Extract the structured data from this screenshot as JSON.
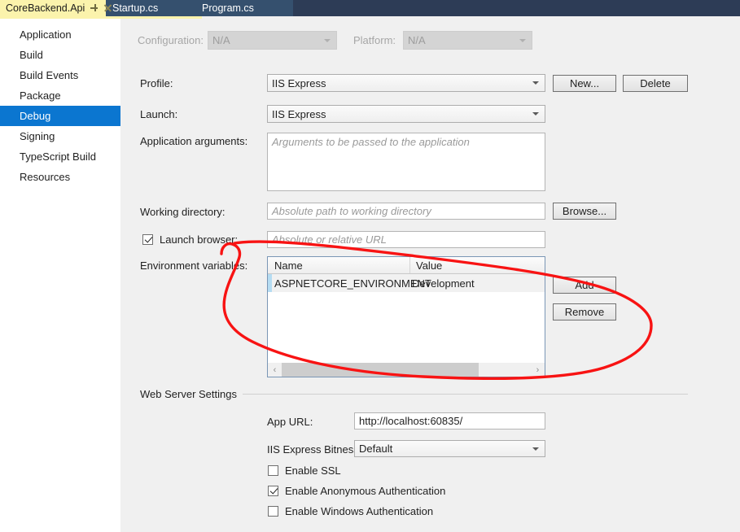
{
  "tabs": {
    "active": {
      "label": "CoreBackend.Api",
      "pin_icon": "pin-icon",
      "close_icon": "close-icon"
    },
    "others": [
      {
        "label": "Startup.cs"
      },
      {
        "label": "Program.cs"
      }
    ]
  },
  "sidebar": {
    "items": [
      {
        "label": "Application",
        "selected": false
      },
      {
        "label": "Build",
        "selected": false
      },
      {
        "label": "Build Events",
        "selected": false
      },
      {
        "label": "Package",
        "selected": false
      },
      {
        "label": "Debug",
        "selected": true
      },
      {
        "label": "Signing",
        "selected": false
      },
      {
        "label": "TypeScript Build",
        "selected": false
      },
      {
        "label": "Resources",
        "selected": false
      }
    ]
  },
  "toolbar": {
    "configuration_label": "Configuration:",
    "configuration_value": "N/A",
    "platform_label": "Platform:",
    "platform_value": "N/A"
  },
  "debug": {
    "profile_label": "Profile:",
    "profile_value": "IIS Express",
    "new_button": "New...",
    "delete_button": "Delete",
    "launch_label": "Launch:",
    "launch_value": "IIS Express",
    "app_args_label": "Application arguments:",
    "app_args_placeholder": "Arguments to be passed to the application",
    "app_args_value": "",
    "working_dir_label": "Working directory:",
    "working_dir_placeholder": "Absolute path to working directory",
    "working_dir_value": "",
    "browse_button": "Browse...",
    "launch_browser_label": "Launch browser:",
    "launch_browser_checked": true,
    "launch_url_placeholder": "Absolute or relative URL",
    "launch_url_value": "",
    "env_vars_label": "Environment variables:",
    "env_grid": {
      "columns": [
        "Name",
        "Value"
      ],
      "rows": [
        {
          "name": "ASPNETCORE_ENVIRONMENT",
          "value": "Development",
          "selected": true
        }
      ],
      "scroll_left_icon": "chevron-left-icon",
      "scroll_right_icon": "chevron-right-icon"
    },
    "add_button": "Add",
    "remove_button": "Remove"
  },
  "web_server": {
    "section_title": "Web Server Settings",
    "app_url_label": "App URL:",
    "app_url_value": "http://localhost:60835/",
    "bitness_label": "IIS Express Bitness:",
    "bitness_value": "Default",
    "checkboxes": [
      {
        "label": "Enable SSL",
        "checked": false
      },
      {
        "label": "Enable Anonymous Authentication",
        "checked": true
      },
      {
        "label": "Enable Windows Authentication",
        "checked": false
      }
    ]
  },
  "annotation": {
    "type": "freehand-ellipse",
    "color": "#f81313"
  },
  "colors": {
    "accent_selection": "#0b76d0",
    "active_tab": "#fbf3ac",
    "tabbar": "#2d3c56",
    "panel": "#f0f0f0",
    "annotation": "#f81313"
  }
}
